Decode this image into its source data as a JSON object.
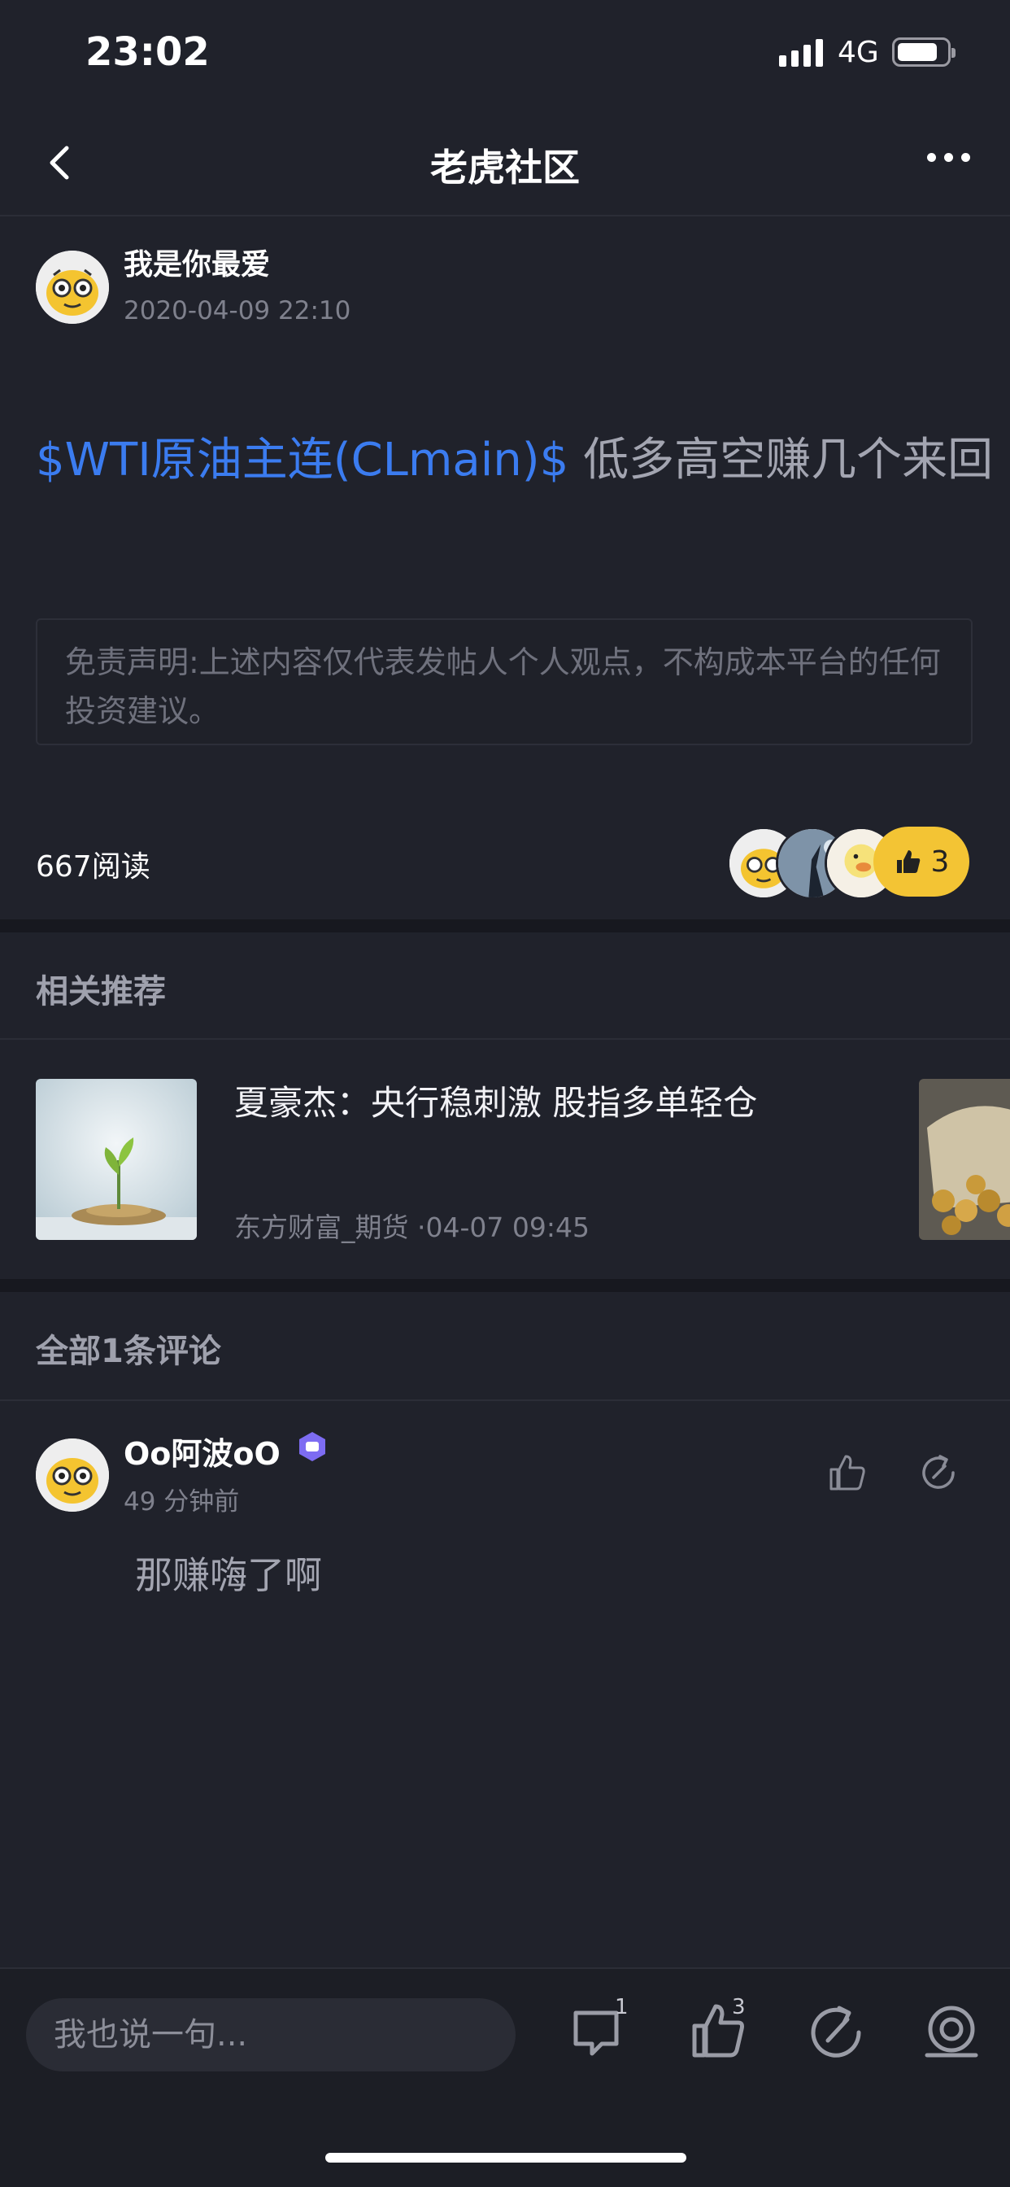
{
  "status_bar": {
    "time": "23:02",
    "network": "4G"
  },
  "nav": {
    "title": "老虎社区"
  },
  "post": {
    "author": "我是你最爱",
    "date": "2020-04-09 22:10",
    "tag": "$WTI原油主连(CLmain)$",
    "body": " 低多高空赚几个来回",
    "disclaimer": "免责声明:上述内容仅代表发帖人个人观点，不构成本平台的任何投资建议。",
    "reads": "667阅读",
    "like_count": "3"
  },
  "related": {
    "title": "相关推荐",
    "items": [
      {
        "title": "夏豪杰：央行稳刺激 股指多单轻仓",
        "source": "东方财富_期货",
        "time": "·04-07 09:45"
      }
    ]
  },
  "comments": {
    "title": "全部1条评论",
    "items": [
      {
        "user": "Oo阿波oO",
        "time": "49 分钟前",
        "text": "那赚嗨了啊"
      }
    ]
  },
  "bottom_bar": {
    "placeholder": "我也说一句...",
    "comment_count": "1",
    "like_count": "3"
  },
  "colors": {
    "background": "#20222b",
    "link": "#3b7cf0",
    "like_yellow": "#f3c434"
  }
}
